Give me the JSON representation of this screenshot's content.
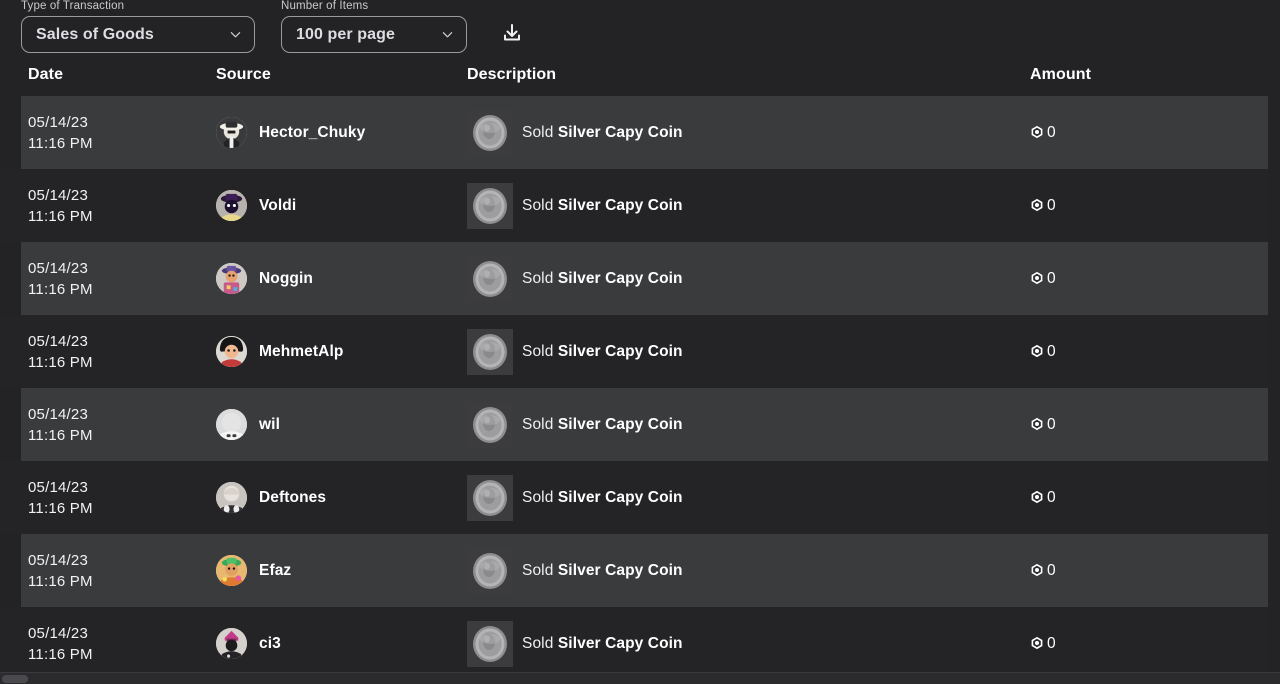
{
  "toolbar": {
    "type_filter": {
      "label": "Type of Transaction",
      "value": "Sales of Goods",
      "icon": "chevron-down-icon"
    },
    "count_filter": {
      "label": "Number of Items",
      "value": "100 per page",
      "icon": "chevron-down-icon"
    },
    "download": {
      "icon": "download-icon"
    }
  },
  "table": {
    "columns": {
      "date": "Date",
      "source": "Source",
      "description": "Description",
      "amount": "Amount"
    },
    "rows": [
      {
        "date": "05/14/23",
        "time": "11:16 PM",
        "source": "Hector_Chuky",
        "avatar": "avatar-hector-chuky",
        "desc_verb": "Sold ",
        "desc_item": "Silver Capy Coin",
        "thumb": "silver-capy-coin-thumbnail",
        "amount": "0",
        "currency_icon": "robux-icon"
      },
      {
        "date": "05/14/23",
        "time": "11:16 PM",
        "source": "Voldi",
        "avatar": "avatar-voldi",
        "desc_verb": "Sold ",
        "desc_item": "Silver Capy Coin",
        "thumb": "silver-capy-coin-thumbnail",
        "amount": "0",
        "currency_icon": "robux-icon"
      },
      {
        "date": "05/14/23",
        "time": "11:16 PM",
        "source": "Noggin",
        "avatar": "avatar-noggin",
        "desc_verb": "Sold ",
        "desc_item": "Silver Capy Coin",
        "thumb": "silver-capy-coin-thumbnail",
        "amount": "0",
        "currency_icon": "robux-icon"
      },
      {
        "date": "05/14/23",
        "time": "11:16 PM",
        "source": "MehmetAlp",
        "avatar": "avatar-mehmetalp",
        "desc_verb": "Sold ",
        "desc_item": "Silver Capy Coin",
        "thumb": "silver-capy-coin-thumbnail",
        "amount": "0",
        "currency_icon": "robux-icon"
      },
      {
        "date": "05/14/23",
        "time": "11:16 PM",
        "source": "wil",
        "avatar": "avatar-wil",
        "desc_verb": "Sold ",
        "desc_item": "Silver Capy Coin",
        "thumb": "silver-capy-coin-thumbnail",
        "amount": "0",
        "currency_icon": "robux-icon"
      },
      {
        "date": "05/14/23",
        "time": "11:16 PM",
        "source": "Deftones",
        "avatar": "avatar-deftones",
        "desc_verb": "Sold ",
        "desc_item": "Silver Capy Coin",
        "thumb": "silver-capy-coin-thumbnail",
        "amount": "0",
        "currency_icon": "robux-icon"
      },
      {
        "date": "05/14/23",
        "time": "11:16 PM",
        "source": "Efaz",
        "avatar": "avatar-efaz",
        "desc_verb": "Sold ",
        "desc_item": "Silver Capy Coin",
        "thumb": "silver-capy-coin-thumbnail",
        "amount": "0",
        "currency_icon": "robux-icon"
      },
      {
        "date": "05/14/23",
        "time": "11:16 PM",
        "source": "ci3",
        "avatar": "avatar-ci3",
        "desc_verb": "Sold ",
        "desc_item": "Silver Capy Coin",
        "thumb": "silver-capy-coin-thumbnail",
        "amount": "0",
        "currency_icon": "robux-icon"
      }
    ]
  },
  "colors": {
    "page_background": "#232326",
    "row_highlight": "#3a3b3d",
    "row_default": "#242426",
    "text_primary": "#ffffff",
    "label_muted": "#c9c9cc",
    "border": "#9a9a9e"
  }
}
